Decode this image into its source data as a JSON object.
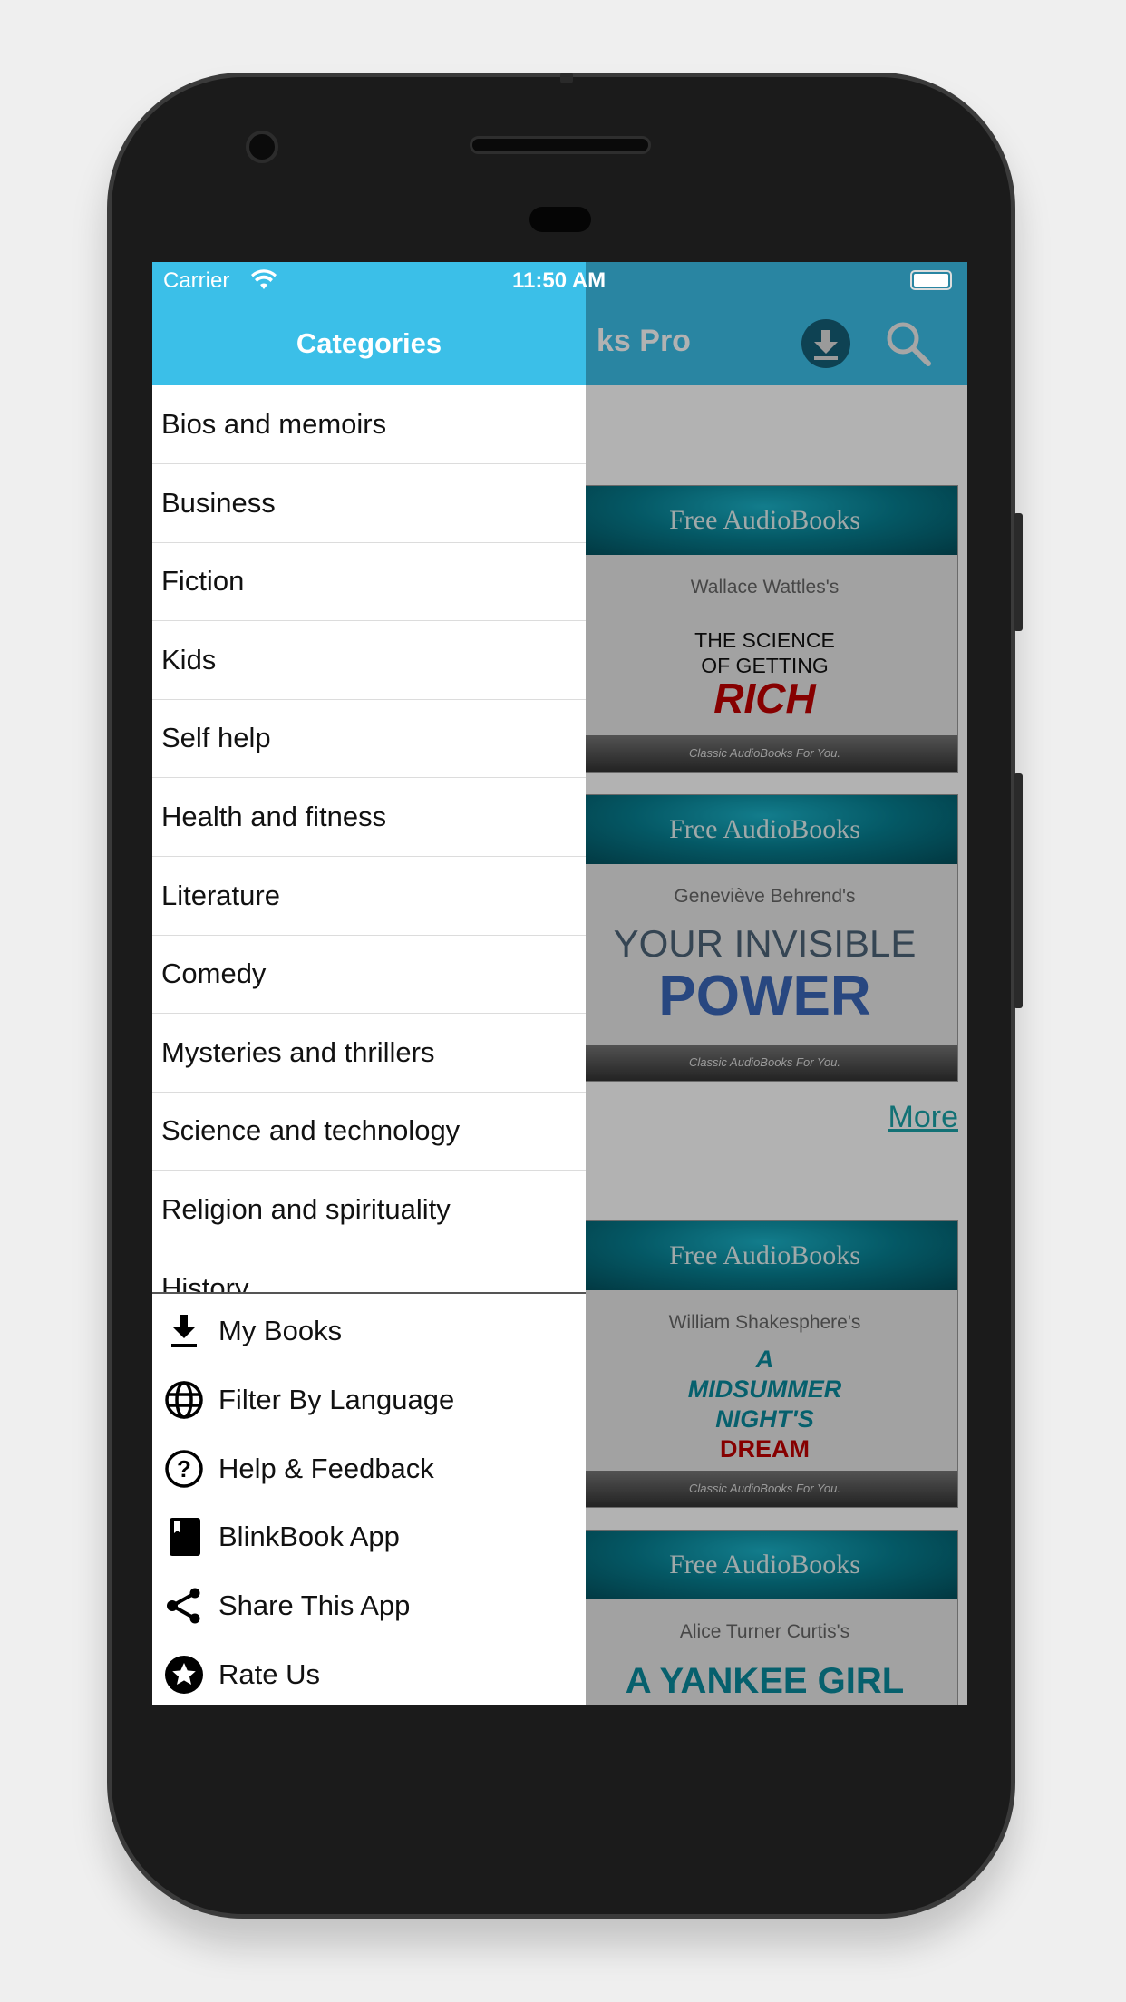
{
  "status_bar": {
    "carrier": "Carrier",
    "time": "11:50 AM"
  },
  "navbar": {
    "title_visible": "ks Pro",
    "icons": [
      "download-icon",
      "search-icon"
    ]
  },
  "drawer": {
    "title": "Categories",
    "categories": [
      "Bios and memoirs",
      "Business",
      "Fiction",
      "Kids",
      "Self help",
      "Health and fitness",
      "Literature",
      "Comedy",
      "Mysteries and thrillers",
      "Science and technology",
      "Religion and spirituality",
      "History"
    ],
    "menu": [
      {
        "label": "My Books",
        "icon": "download-icon"
      },
      {
        "label": "Filter By Language",
        "icon": "globe-icon"
      },
      {
        "label": "Help & Feedback",
        "icon": "help-circle-icon"
      },
      {
        "label": "BlinkBook App",
        "icon": "book-icon"
      },
      {
        "label": "Share This App",
        "icon": "share-icon"
      },
      {
        "label": "Rate Us",
        "icon": "star-circle-icon"
      }
    ]
  },
  "content": {
    "cover_header": "Free AudioBooks",
    "cover_footer": "Classic AudioBooks For You.",
    "more_label": "More",
    "books": [
      {
        "author": "Wallace Wattles's",
        "title_lines": [
          "THE SCIENCE",
          "OF GETTING",
          "RICH"
        ]
      },
      {
        "author": "Geneviève Behrend's",
        "title_lines": [
          "YOUR INVISIBLE",
          "POWER"
        ]
      },
      {
        "author": "William Shakesphere's",
        "title_lines": [
          "A",
          "MIDSUMMER",
          "NIGHT'S",
          "DREAM"
        ]
      },
      {
        "author": "Alice Turner Curtis's",
        "title_lines": [
          "A YANKEE GIRL"
        ]
      }
    ]
  },
  "colors": {
    "accent": "#3bbfe8",
    "link": "#1aa3a8",
    "teal": "#0a8a9c",
    "red": "#c00000",
    "blue": "#3a66b8"
  }
}
